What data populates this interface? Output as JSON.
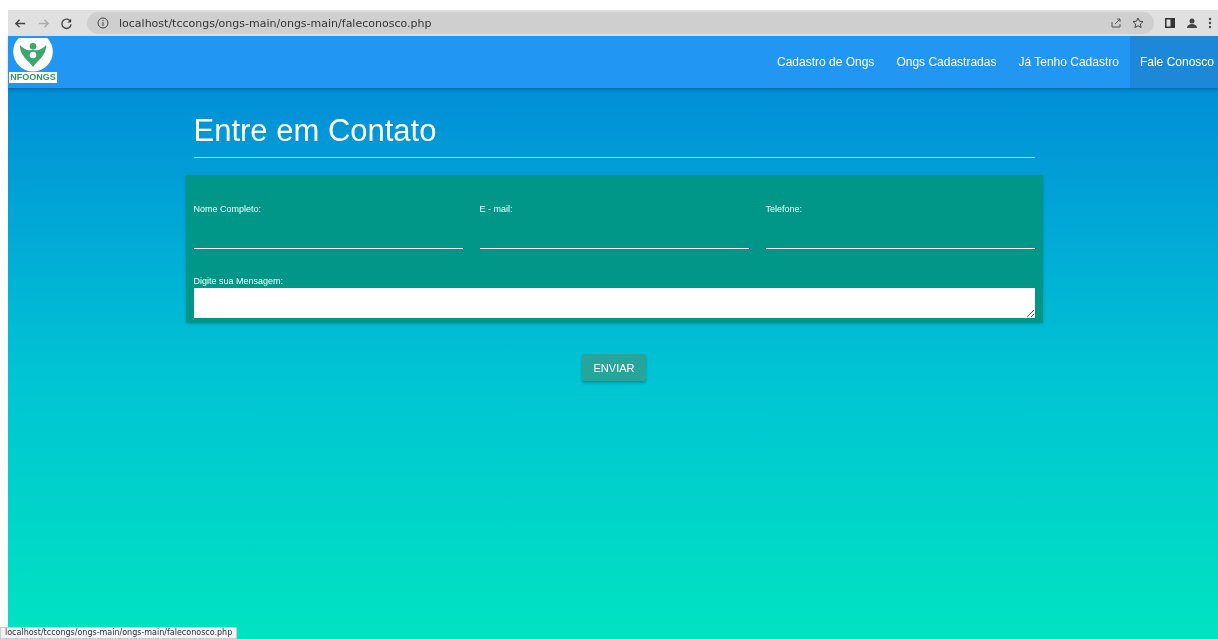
{
  "browser": {
    "url": "localhost/tccongs/ongs-main/ongs-main/faleconosco.php",
    "status_url": "localhost/tccongs/ongs-main/ongs-main/faleconosco.php"
  },
  "logo": {
    "text": "NFOONGS"
  },
  "nav": [
    {
      "label": "Cadastro de Ongs",
      "selected": false
    },
    {
      "label": "Ongs Cadastradas",
      "selected": false
    },
    {
      "label": "Já Tenho Cadastro",
      "selected": false
    },
    {
      "label": "Fale Conosco",
      "selected": true
    }
  ],
  "heading": "Entre em Contato",
  "fields": [
    {
      "label": "Nome Completo:"
    },
    {
      "label": "E - mail:"
    },
    {
      "label": "Telefone:"
    }
  ],
  "message": {
    "label": "Digite sua Mensagem:"
  },
  "submit": "ENVIAR"
}
